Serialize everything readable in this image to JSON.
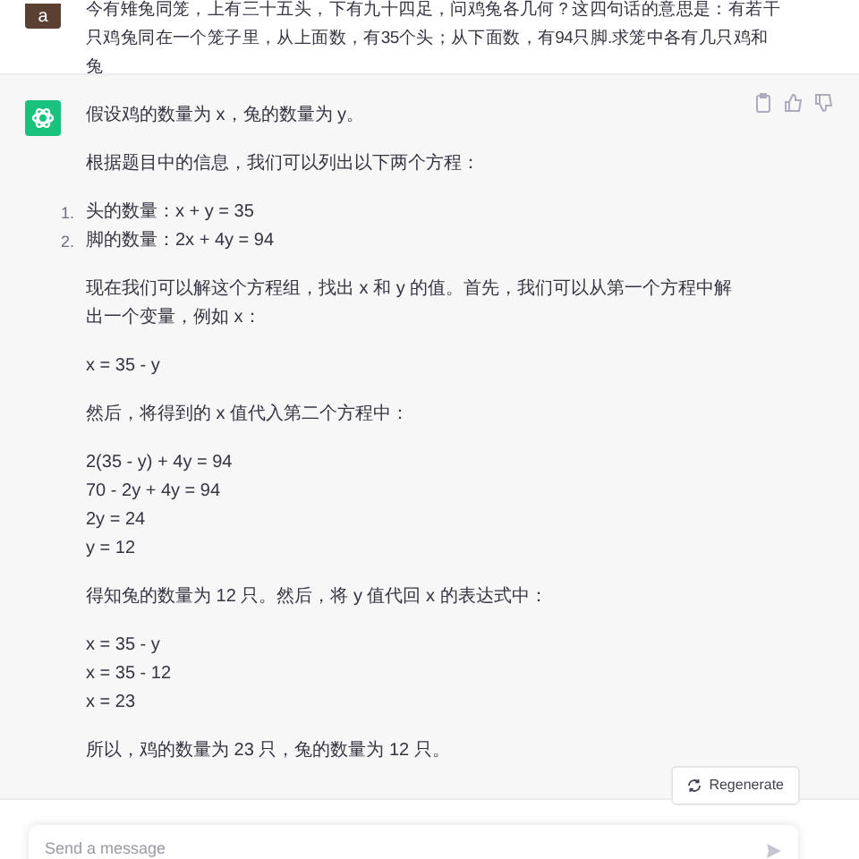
{
  "user_message": {
    "avatar": "a",
    "text": "今有雉兔同笼，上有三十五头，下有九十四足，问鸡兔各几何？这四句话的意思是：有若干只鸡兔同在一个笼子里，从上面数，有35个头；从下面数，有94只脚.求笼中各有几只鸡和兔"
  },
  "assistant_message": {
    "blocks": [
      {
        "kind": "paragraph",
        "text": "假设鸡的数量为 x，兔的数量为 y。"
      },
      {
        "kind": "paragraph",
        "text": "根据题目中的信息，我们可以列出以下两个方程："
      },
      {
        "kind": "list",
        "items": [
          {
            "marker": "1.",
            "text": "头的数量：x + y = 35"
          },
          {
            "marker": "2.",
            "text": "脚的数量：2x + 4y = 94"
          }
        ]
      },
      {
        "kind": "paragraph",
        "text": "现在我们可以解这个方程组，找出 x 和 y 的值。首先，我们可以从第一个方程中解出一个变量，例如 x："
      },
      {
        "kind": "lines",
        "lines": [
          "x = 35 - y"
        ]
      },
      {
        "kind": "paragraph",
        "text": "然后，将得到的 x 值代入第二个方程中："
      },
      {
        "kind": "lines",
        "lines": [
          "2(35 - y) + 4y = 94",
          "70 - 2y + 4y = 94",
          "2y = 24",
          "y = 12"
        ]
      },
      {
        "kind": "paragraph",
        "text": "得知兔的数量为 12 只。然后，将 y 值代回 x 的表达式中："
      },
      {
        "kind": "lines",
        "lines": [
          "x = 35 - y",
          "x = 35 - 12",
          "x = 23"
        ]
      },
      {
        "kind": "paragraph",
        "text": "所以，鸡的数量为 23 只，兔的数量为 12 只。"
      }
    ]
  },
  "regenerate_button": {
    "label": "Regenerate"
  },
  "composer": {
    "placeholder": "Send a message"
  }
}
